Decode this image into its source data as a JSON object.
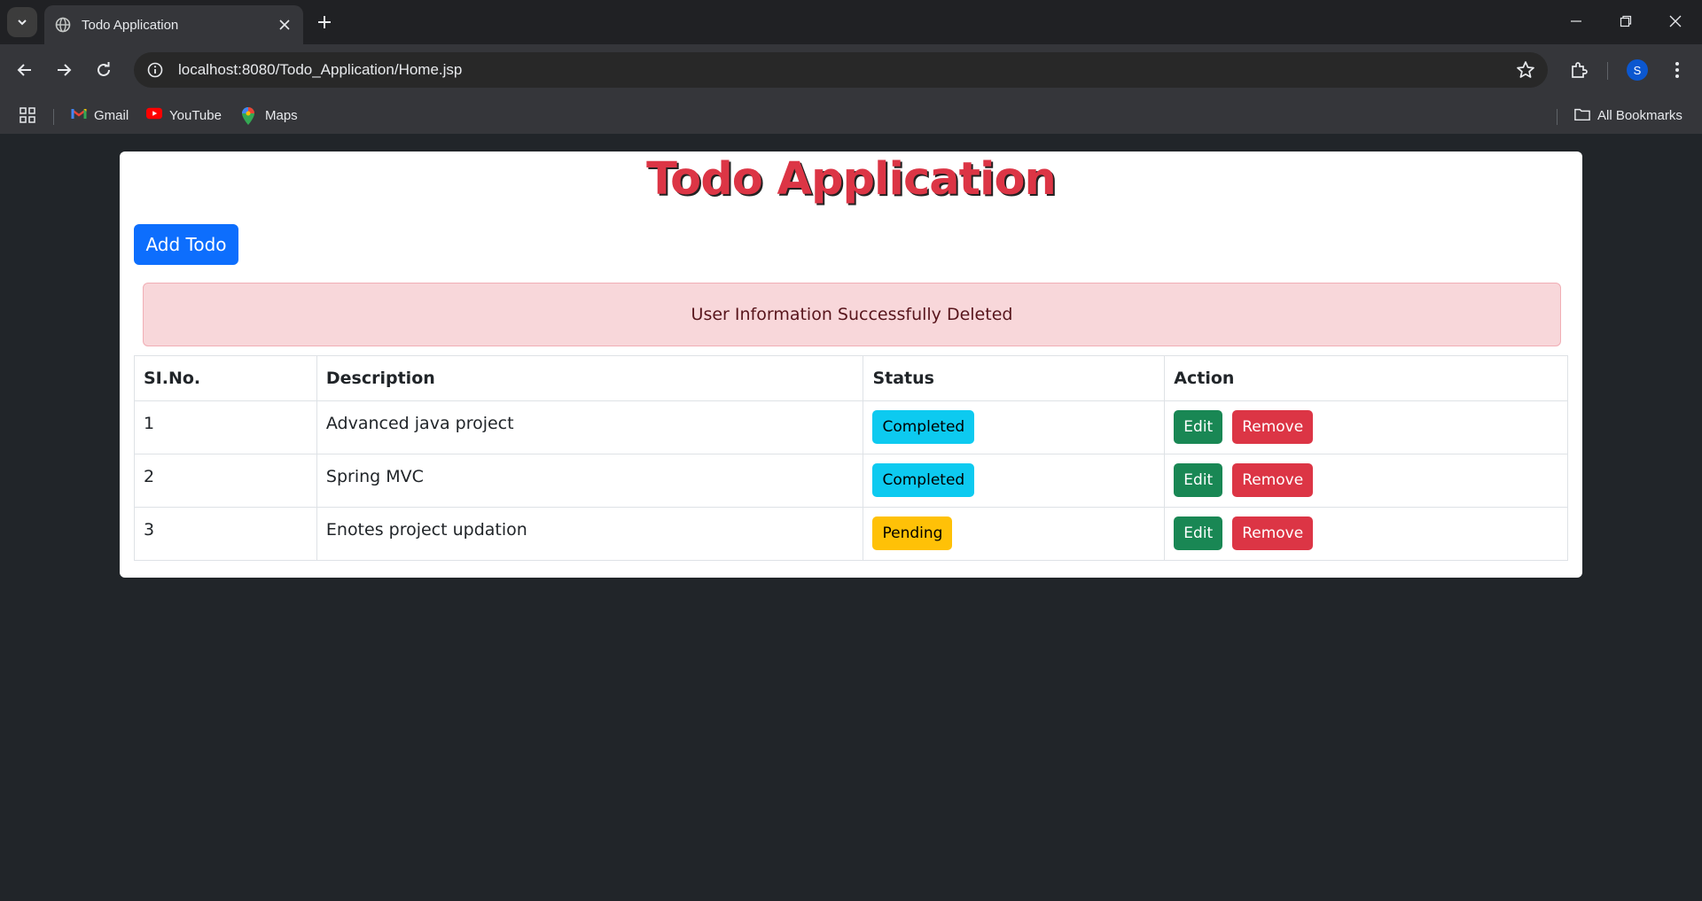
{
  "browser": {
    "tab_title": "Todo Application",
    "url": "localhost:8080/Todo_Application/Home.jsp",
    "profile_initial": "S",
    "bookmarks": [
      {
        "label": "Gmail",
        "icon": "gmail-icon"
      },
      {
        "label": "YouTube",
        "icon": "youtube-icon"
      },
      {
        "label": "Maps",
        "icon": "maps-icon"
      }
    ],
    "all_bookmarks_label": "All Bookmarks"
  },
  "page": {
    "title": "Todo Application",
    "add_button_label": "Add Todo",
    "alert_message": "User Information Successfully Deleted",
    "table": {
      "headers": [
        "SI.No.",
        "Description",
        "Status",
        "Action"
      ],
      "rows": [
        {
          "sl_no": "1",
          "description": "Advanced java project",
          "status": "Completed",
          "edit": "Edit",
          "remove": "Remove"
        },
        {
          "sl_no": "2",
          "description": "Spring MVC",
          "status": "Completed",
          "edit": "Edit",
          "remove": "Remove"
        },
        {
          "sl_no": "3",
          "description": "Enotes project updation",
          "status": "Pending",
          "edit": "Edit",
          "remove": "Remove"
        }
      ]
    }
  },
  "colors": {
    "page_bg": "#212529",
    "title_red": "#dc3545",
    "primary_blue": "#0d6efd",
    "alert_bg": "#f8d7da",
    "badge_completed": "#0dcaf0",
    "badge_pending": "#ffc107",
    "edit_green": "#198754",
    "remove_red": "#dc3545"
  }
}
